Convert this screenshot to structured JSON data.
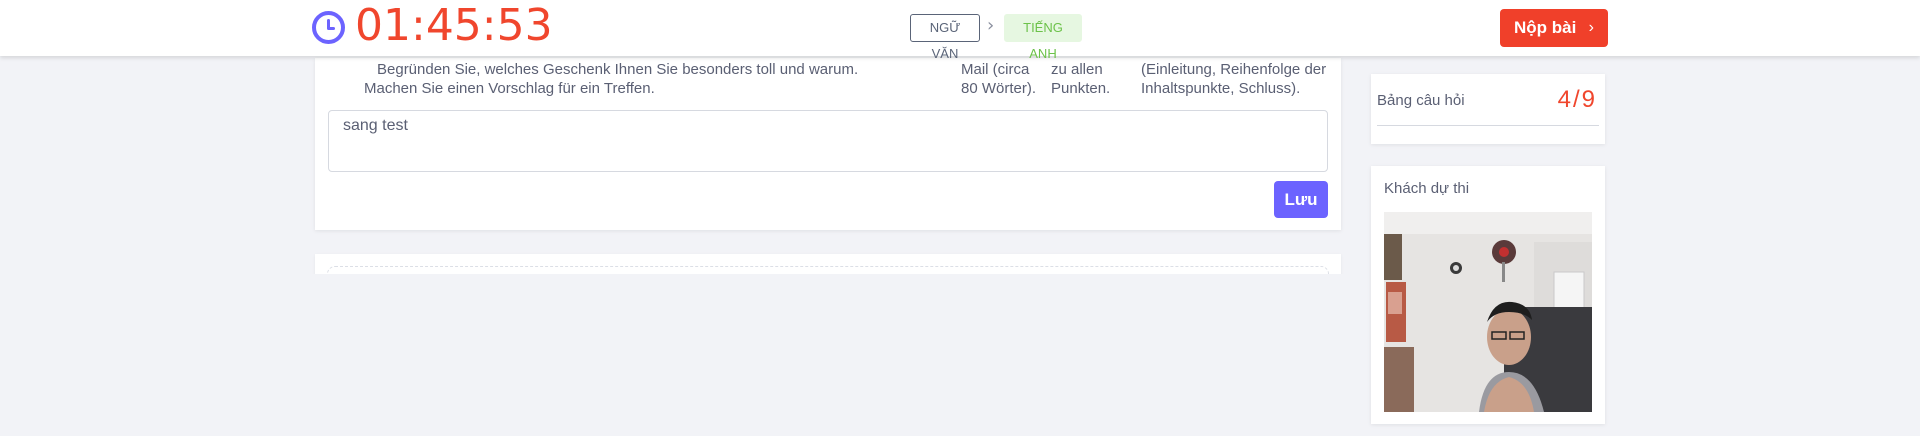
{
  "header": {
    "timer": "01:45:53",
    "breadcrumb": [
      {
        "label": "NGỮ VĂN"
      },
      {
        "label": "TIẾNG ANH"
      }
    ],
    "submit_label": "Nộp bài"
  },
  "question": {
    "text_line1": "Begründen Sie, welches Geschenk Ihnen Sie besonders toll und warum.",
    "text_line2": "Machen Sie einen Vorschlag für ein Treffen.",
    "col2_line1": "Mail (circa",
    "col2_line2": "80 Wörter).",
    "col3_line1": "zu allen",
    "col3_line2": "Punkten.",
    "col4_line1": "(Einleitung, Reihenfolge der",
    "col4_line2": "Inhaltspunkte, Schluss)."
  },
  "answer": {
    "value": "sang test",
    "save_label": "Lưu"
  },
  "sidebar": {
    "questions_title": "Bảng câu hỏi",
    "questions_count": "4/9",
    "candidate_title": "Khách dự thi"
  },
  "colors": {
    "accent": "#6c63ff",
    "danger": "#f0402a",
    "timer": "#f0462d",
    "tag_green": "#6cc24a"
  }
}
